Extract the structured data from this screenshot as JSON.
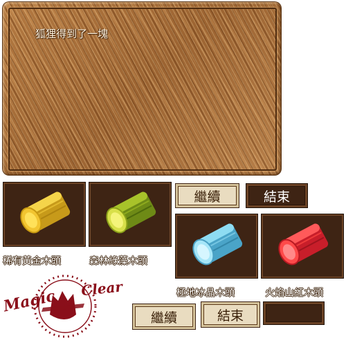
{
  "dialog": {
    "text": "狐狸得到了一塊"
  },
  "items": [
    {
      "label": "稀有黃金木頭",
      "color": "#f2c531",
      "core": "#ffe15a"
    },
    {
      "label": "森林綠藻木頭",
      "color": "#9cb21e",
      "core": "#e8ee4a"
    },
    {
      "label": "極地冰晶木頭",
      "color": "#6cc7e6",
      "core": "#b2ecfa"
    },
    {
      "label": "火焰山紅木頭",
      "color": "#ee3a3a",
      "core": "#ff7070"
    }
  ],
  "buttons": {
    "continue_label": "繼續",
    "end_label": "結束",
    "continue_pressed_label": "繼續",
    "end_pressed_label": "結束",
    "empty_label": ""
  },
  "logo": {
    "text": "Magic Clear"
  }
}
